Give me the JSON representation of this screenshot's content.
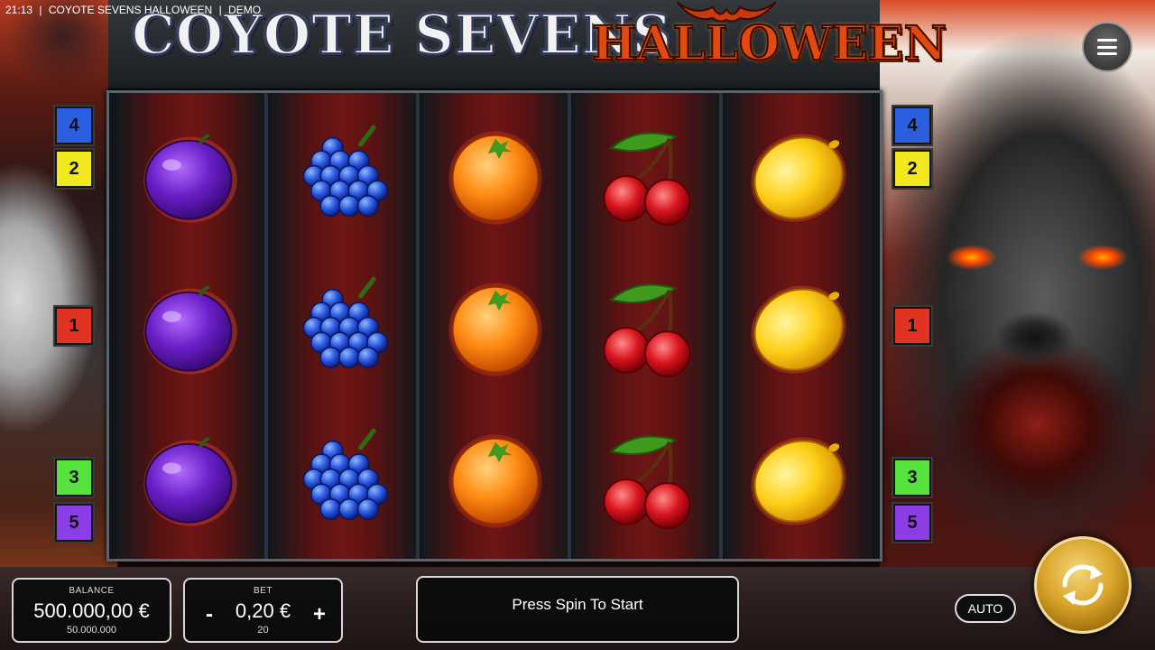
{
  "status": {
    "time": "21:13",
    "game_name": "COYOTE SEVENS HALLOWEEN",
    "mode": "DEMO",
    "separator": "|"
  },
  "title": {
    "main": "COYOTE SEVENS",
    "accent": "HALLOWEEN"
  },
  "reels": [
    [
      "plum",
      "plum",
      "plum"
    ],
    [
      "grapes",
      "grapes",
      "grapes"
    ],
    [
      "orange",
      "orange",
      "orange"
    ],
    [
      "cherries",
      "cherries",
      "cherries"
    ],
    [
      "lemon",
      "lemon",
      "lemon"
    ]
  ],
  "paylines": {
    "left": [
      {
        "number": "4",
        "color": "#2c5fe0"
      },
      {
        "number": "2",
        "color": "#f2e81e"
      },
      {
        "number": "1",
        "color": "#e03322"
      },
      {
        "number": "3",
        "color": "#56e33d"
      },
      {
        "number": "5",
        "color": "#8b3ee6"
      }
    ],
    "right": [
      {
        "number": "4",
        "color": "#2c5fe0"
      },
      {
        "number": "2",
        "color": "#f2e81e"
      },
      {
        "number": "1",
        "color": "#e03322"
      },
      {
        "number": "3",
        "color": "#56e33d"
      },
      {
        "number": "5",
        "color": "#8b3ee6"
      }
    ]
  },
  "balance": {
    "label": "BALANCE",
    "value": "500.000,00 €",
    "credits": "50.000.000"
  },
  "bet": {
    "label": "BET",
    "value": "0,20 €",
    "lines": "20",
    "decrease": "-",
    "increase": "+"
  },
  "message": "Press Spin To Start",
  "auto_label": "AUTO",
  "icons": {
    "menu": "hamburger-menu-icon",
    "spin": "spin-arrows-icon"
  },
  "colors": {
    "frame": "#5a646c",
    "reel_glow": "#6e1515",
    "spin_gold": "#d9a52a"
  }
}
